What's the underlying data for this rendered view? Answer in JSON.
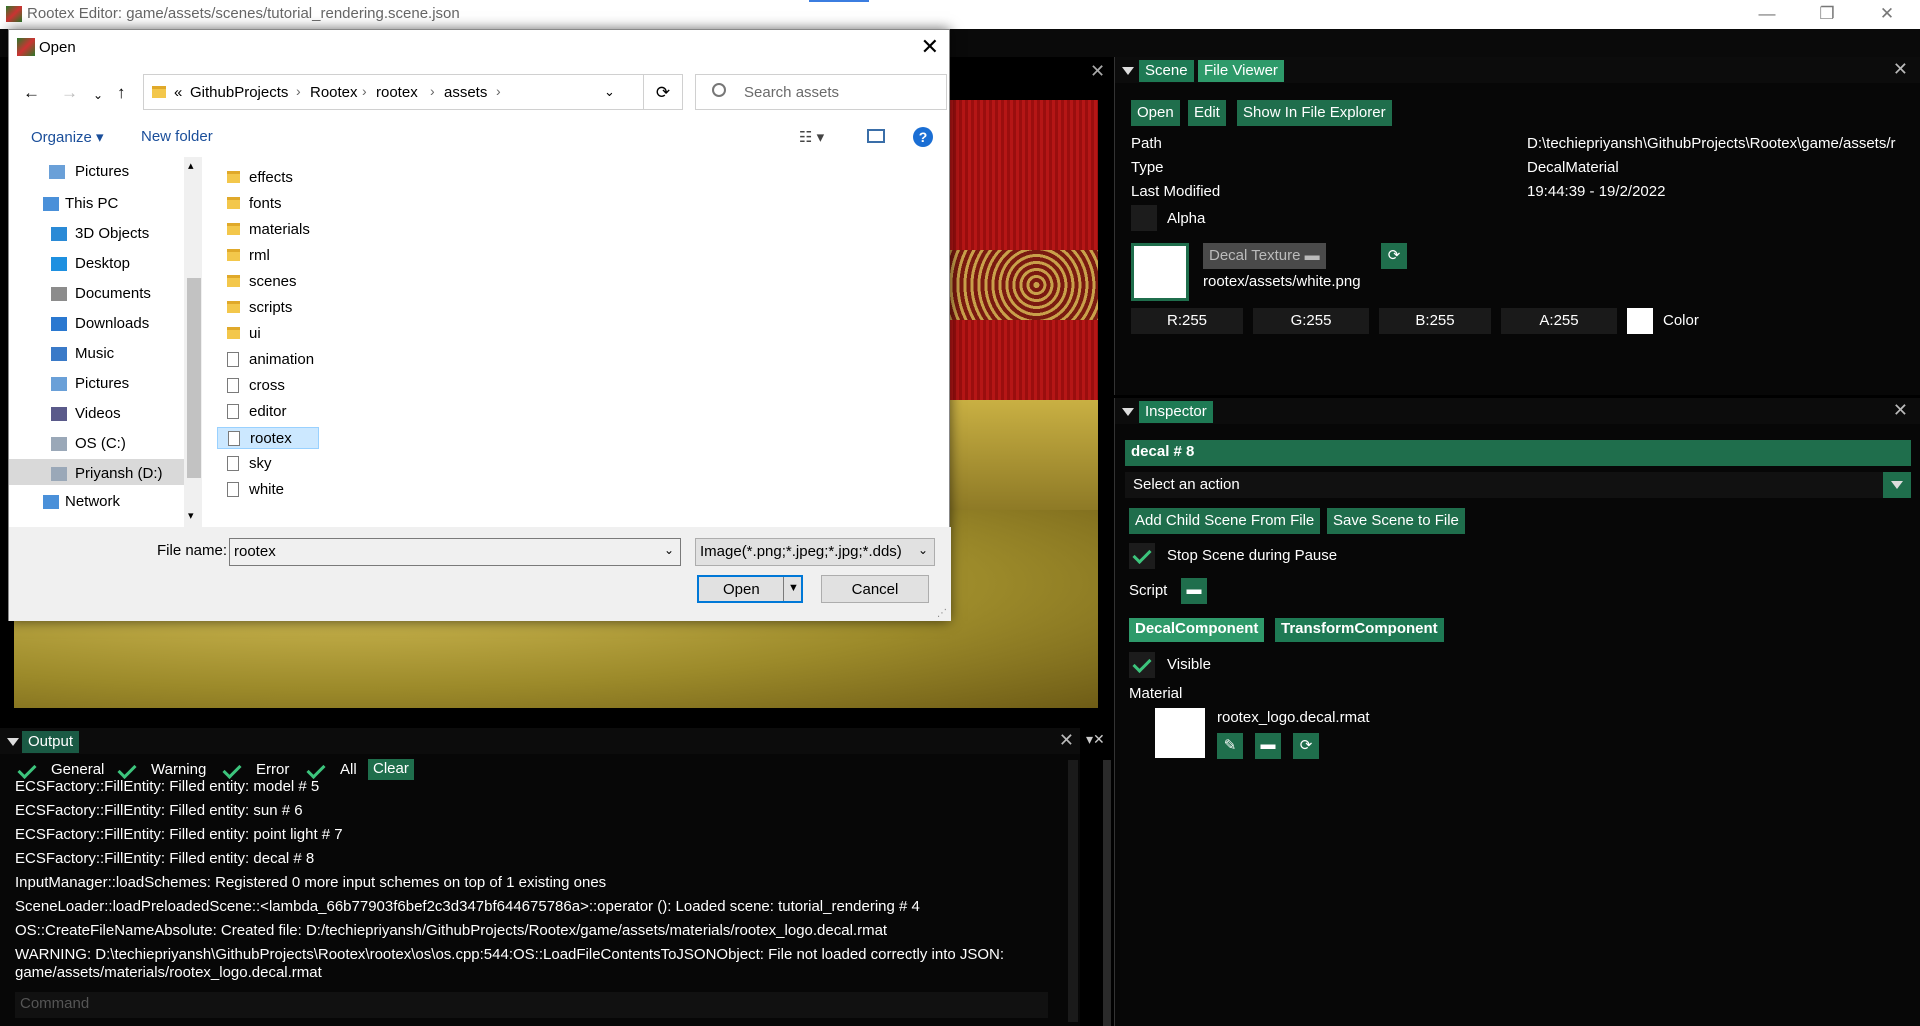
{
  "window": {
    "title": "Rootex Editor: game/assets/scenes/tutorial_rendering.scene.json",
    "minimize": "—",
    "restore": "❐",
    "close": "✕"
  },
  "scene_panel": {
    "tabs": [
      "Scene",
      "File Viewer"
    ],
    "buttons": [
      "Open",
      "Edit",
      "Show In File Explorer"
    ],
    "props": [
      {
        "label": "Path",
        "value": "D:\\techiepriyansh\\GithubProjects\\Rootex\\game/assets/r"
      },
      {
        "label": "Type",
        "value": "DecalMaterial"
      },
      {
        "label": "Last Modified",
        "value": "19:44:39 - 19/2/2022"
      }
    ],
    "alpha_label": "Alpha",
    "decal_texture_button": "Decal Texture",
    "texture_path": "rootex/assets/white.png",
    "rgba": [
      "R:255",
      "G:255",
      "B:255",
      "A:255"
    ],
    "color_label": "Color"
  },
  "inspector": {
    "tab": "Inspector",
    "entity": "decal # 8",
    "action_placeholder": "Select an action",
    "buttons": [
      "Add Child Scene From File",
      "Save Scene to File"
    ],
    "stop_scene_label": "Stop Scene during Pause",
    "script_label": "Script",
    "component_tabs": [
      "DecalComponent",
      "TransformComponent"
    ],
    "visible_label": "Visible",
    "material_label": "Material",
    "material_file": "rootex_logo.decal.rmat"
  },
  "output": {
    "tab": "Output",
    "filters": [
      "General",
      "Warning",
      "Error",
      "All"
    ],
    "clear_label": "Clear",
    "lines": [
      "ECSFactory::FillEntity: Filled entity: model # 5",
      "ECSFactory::FillEntity: Filled entity: sun # 6",
      "ECSFactory::FillEntity: Filled entity: point light # 7",
      "ECSFactory::FillEntity: Filled entity: decal # 8",
      "InputManager::loadSchemes: Registered 0 more input schemes on top of 1 existing ones",
      "SceneLoader::loadPreloadedScene::<lambda_66b77903f6bef2c3d347bf644675786a>::operator (): Loaded scene: tutorial_rendering # 4",
      "OS::CreateFileNameAbsolute: Created file: D:/techiepriyansh/GithubProjects/Rootex/game/assets/materials/rootex_logo.decal.rmat",
      "WARNING: D:\\techiepriyansh\\GithubProjects\\Rootex\\rootex\\os\\os.cpp:544:OS::LoadFileContentsToJSONObject: File not loaded correctly into JSON:",
      "game/assets/materials/rootex_logo.decal.rmat"
    ],
    "command_placeholder": "Command"
  },
  "dialog": {
    "title": "Open",
    "breadcrumb": [
      "«",
      "GithubProjects",
      "Rootex",
      "rootex",
      "assets"
    ],
    "search_placeholder": "Search assets",
    "organize": "Organize ▾",
    "new_folder": "New folder",
    "nav_items": [
      "Pictures",
      "This PC",
      "3D Objects",
      "Desktop",
      "Documents",
      "Downloads",
      "Music",
      "Pictures",
      "Videos",
      "OS (C:)",
      "Priyansh (D:)",
      "Network"
    ],
    "folders": [
      "effects",
      "fonts",
      "materials",
      "rml",
      "scenes",
      "scripts",
      "ui"
    ],
    "files": [
      "animation",
      "cross",
      "editor",
      "rootex",
      "sky",
      "white"
    ],
    "selected_file": "rootex",
    "file_name_label": "File name:",
    "file_name_value": "rootex",
    "file_type": "Image(*.png;*.jpeg;*.jpg;*.dds)",
    "open_button": "Open",
    "cancel_button": "Cancel"
  }
}
